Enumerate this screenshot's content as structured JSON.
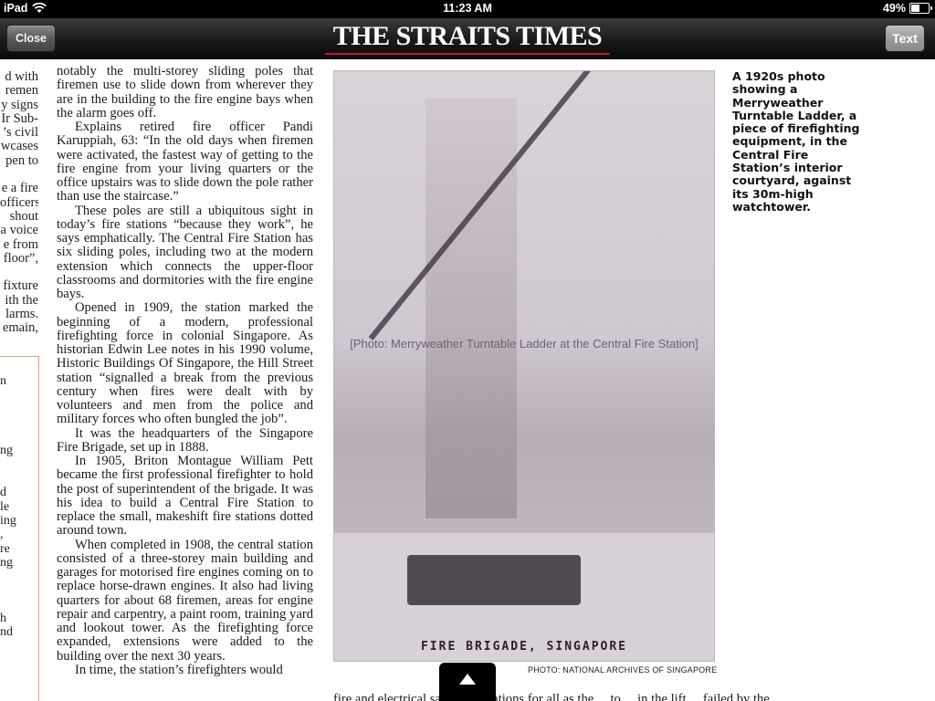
{
  "status_bar": {
    "device": "iPad",
    "time": "11:23 AM",
    "battery": "49%",
    "battery_level": 0.49,
    "icons": [
      "wifi-icon",
      "battery-icon"
    ]
  },
  "toolbar": {
    "close_label": "Close",
    "title": "THE STRAITS TIMES",
    "text_label": "Text",
    "accent_color": "#c8102e"
  },
  "left_fragments": [
    "d with",
    "remen",
    "y signs",
    "Ir Sub-",
    "’s civil",
    "wcases",
    "pen to",
    "",
    "e a fire",
    "officers",
    "shout",
    "a voice",
    "e from",
    "floor”,",
    "",
    "fixture",
    "ith the",
    "larms.",
    "emain,"
  ],
  "sidebar_fragments": [
    "n",
    "",
    "",
    "",
    "",
    "ng",
    "",
    "",
    "d",
    "le",
    "ing",
    ",",
    "re",
    "ng",
    "",
    "",
    "",
    "h",
    "nd"
  ],
  "article": {
    "paragraphs": [
      "notably the multi-storey sliding poles that firemen use to slide down from wherever they are in the building to the fire engine bays when the alarm goes off.",
      "Explains retired fire officer Pandi Karuppiah, 63: “In the old days when firemen were activated, the fastest way of getting to the fire engine from your living quarters or the office upstairs was to slide down the pole rather than use the staircase.”",
      "These poles are still a ubiquitous sight in today’s fire stations “because they work”, he says emphatically. The Central Fire Station has six sliding poles, including two at the modern extension which connects the upper-floor classrooms and dormitories with the fire engine bays.",
      "Opened in 1909, the station marked the beginning of a modern, professional firefighting force in colonial Singapore. As historian Edwin Lee notes in his 1990 volume, Historic Buildings Of Singapore, the Hill Street station “signalled a break from the previous century when fires were dealt with by volunteers and men from the police and military forces who often bungled the job”.",
      "It was the headquarters of the Singapore Fire Brigade, set up in 1888.",
      "In 1905, Briton Montague William Pett became the first professional firefighter to hold the post of superintendent of the brigade. It was his idea to build a Central Fire Station to replace the small, makeshift fire stations dotted around town.",
      "When completed in 1908, the central station consisted of a three-storey main building and garages for motorised fire engines coming on to replace horse-drawn engines. It also had living quarters for about 68 firemen, areas for engine repair and carpentry, a paint room, training yard and lookout tower. As the firefighting force expanded, extensions were added to the building over the next 30 years.",
      "In time, the station’s firefighters would"
    ]
  },
  "photo": {
    "placeholder": "[Photo: Merryweather Turntable Ladder at the Central Fire Station]",
    "inscription": "FIRE BRIGADE, SINGAPORE",
    "caption": "A 1920s photo showing a Merryweather Turntable Ladder, a piece of firefighting equipment, in the Central Fire Station’s interior courtyard, against its 30m-high watchtower.",
    "credit": "PHOTO: NATIONAL ARCHIVES OF SINGAPORE"
  },
  "bottom_strip": "fire and electrical safety regulations for all as the ... to ... in the lift ... failed by the ...",
  "page_up_icon": "chevron-up-icon"
}
